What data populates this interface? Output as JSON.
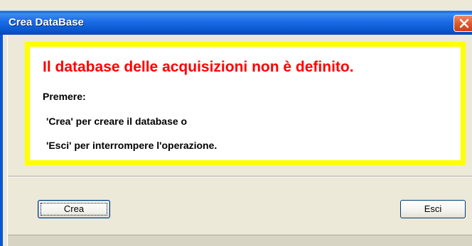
{
  "window": {
    "title": "Crea DataBase"
  },
  "message": {
    "headline": "Il database delle acquisizioni non è definito.",
    "line1": "Premere:",
    "line2": "'Crea' per creare il database o",
    "line3": "'Esci' per interrompere l'operazione."
  },
  "buttons": {
    "create_label": "Crea",
    "exit_label": "Esci"
  },
  "colors": {
    "titlebar": "#0a58d0",
    "headline": "#ff0000",
    "message_border": "#ffff00",
    "close_button": "#e05a2a"
  },
  "icons": {
    "close": "close-icon"
  }
}
